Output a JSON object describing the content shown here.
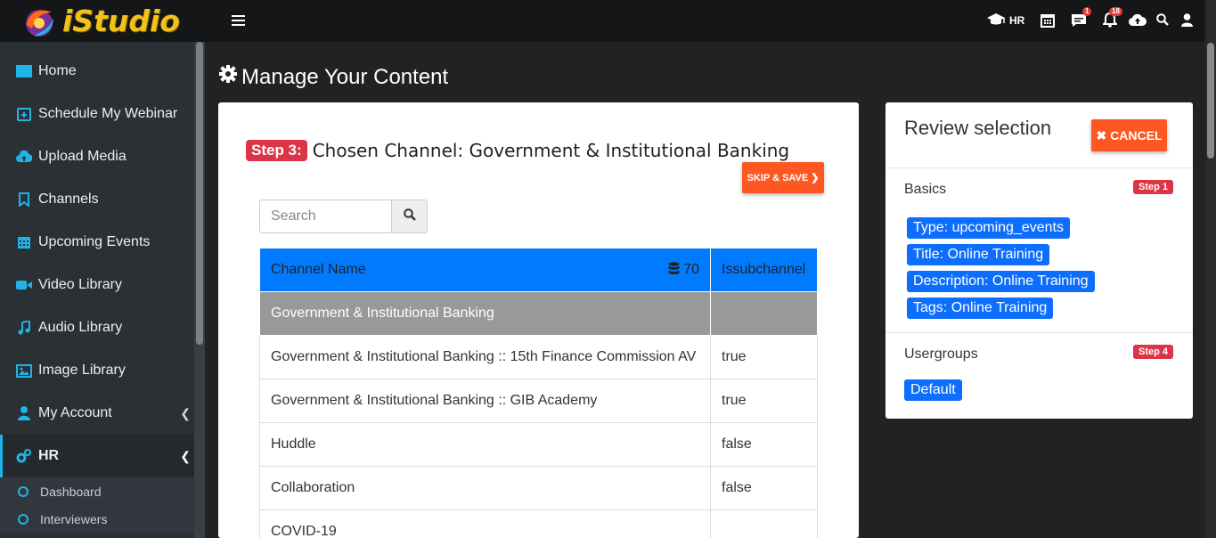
{
  "app": {
    "name": "iStudio"
  },
  "topbar": {
    "role_label": "HR",
    "chat_badge": "1",
    "notifications_badge": "18"
  },
  "sidebar": {
    "items": [
      {
        "label": "Home",
        "icon": "home-icon"
      },
      {
        "label": "Schedule My Webinar",
        "icon": "calendar-plus-icon"
      },
      {
        "label": "Upload Media",
        "icon": "cloud-upload-icon"
      },
      {
        "label": "Channels",
        "icon": "bookmark-icon"
      },
      {
        "label": "Upcoming Events",
        "icon": "calendar-icon"
      },
      {
        "label": "Video Library",
        "icon": "video-camera-icon"
      },
      {
        "label": "Audio Library",
        "icon": "music-note-icon"
      },
      {
        "label": "Image Library",
        "icon": "image-icon"
      },
      {
        "label": "My Account",
        "icon": "user-icon"
      },
      {
        "label": "HR",
        "icon": "gears-icon"
      }
    ],
    "sub_items": [
      {
        "label": "Dashboard"
      },
      {
        "label": "Interviewers"
      }
    ]
  },
  "page": {
    "title": "Manage Your Content"
  },
  "main": {
    "step_badge": "Step 3:",
    "step_text": "Chosen Channel: Government & Institutional Banking",
    "skip_label": "SKIP & SAVE",
    "search_placeholder": "Search",
    "table": {
      "headers": [
        "Channel Name",
        "Issubchannel"
      ],
      "count": "70",
      "group": "Government & Institutional Banking",
      "rows": [
        {
          "name": "Government & Institutional Banking :: 15th Finance Commission AV",
          "sub": "true"
        },
        {
          "name": "Government & Institutional Banking :: GIB Academy",
          "sub": "true"
        },
        {
          "name": "Huddle",
          "sub": "false"
        },
        {
          "name": "Collaboration",
          "sub": "false"
        },
        {
          "name": "COVID-19",
          "sub": ""
        }
      ]
    }
  },
  "review": {
    "title": "Review selection",
    "cancel_label": "CANCEL",
    "basics_label": "Basics",
    "basics_step": "Step 1",
    "chips": [
      "Type: upcoming_events",
      "Title: Online Training",
      "Description: Online Training",
      "Tags: Online Training"
    ],
    "usergroups_label": "Usergroups",
    "usergroups_step": "Step 4",
    "usergroup_chip": "Default"
  },
  "colors": {
    "accent": "#1fb4e5",
    "primary": "#007bff",
    "danger": "#dc3545",
    "orange": "#ff5722"
  }
}
